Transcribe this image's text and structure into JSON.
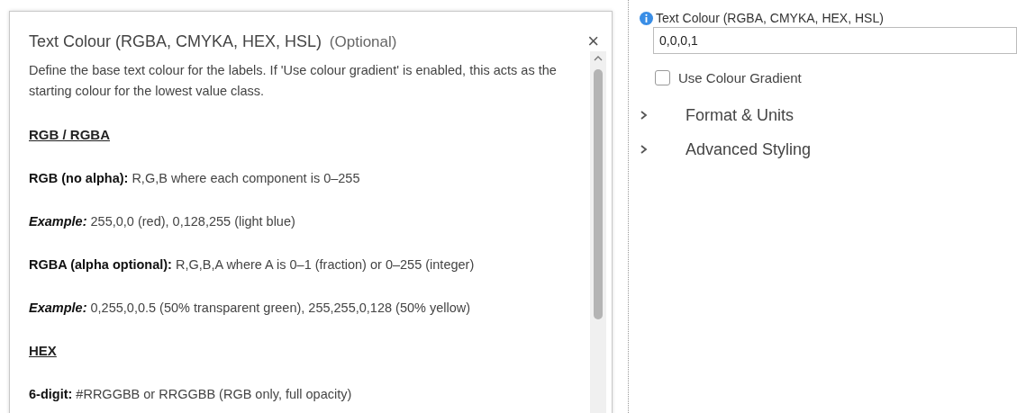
{
  "help_popup": {
    "title": "Text Colour (RGBA, CMYKA, HEX, HSL)",
    "title_note": "(Optional)",
    "close": "×",
    "blocks": [
      {
        "kind": "paragraph",
        "text": "Define the base text colour for the labels. If 'Use colour gradient' is enabled, this acts as the starting colour for the lowest value class."
      },
      {
        "kind": "heading",
        "text": "RGB / RGBA"
      },
      {
        "kind": "item",
        "label": "RGB (no alpha):",
        "text": "R,G,B where each component is 0–255"
      },
      {
        "kind": "example",
        "label": "Example:",
        "text": "255,0,0 (red), 0,128,255 (light blue)"
      },
      {
        "kind": "item",
        "label": "RGBA (alpha optional):",
        "text": "R,G,B,A where A is 0–1 (fraction) or 0–255 (integer)"
      },
      {
        "kind": "example",
        "label": "Example:",
        "text": "0,255,0,0.5 (50% transparent green), 255,255,0,128 (50% yellow)"
      },
      {
        "kind": "heading",
        "text": "HEX"
      },
      {
        "kind": "item",
        "label": "6-digit:",
        "text": "#RRGGBB or RRGGBB (RGB only, full opacity)"
      }
    ]
  },
  "properties": {
    "field_label": "Text Colour (RGBA, CMYKA, HEX, HSL)",
    "field_value": "0,0,0,1",
    "checkbox": {
      "label": "Use Colour Gradient",
      "checked": false
    },
    "groups": [
      {
        "label": "Format & Units",
        "expanded": false
      },
      {
        "label": "Advanced Styling",
        "expanded": false
      }
    ]
  }
}
